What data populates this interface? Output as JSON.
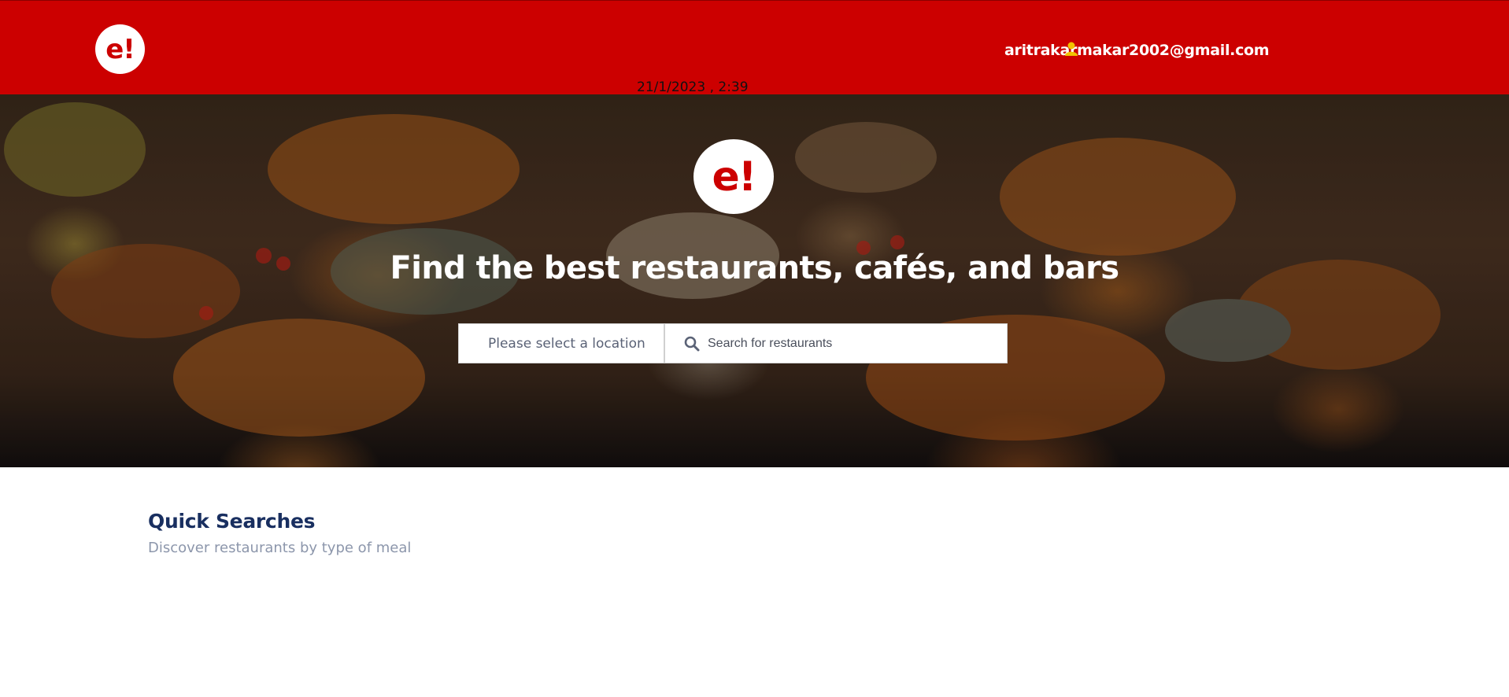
{
  "header": {
    "logo_text": "e!",
    "user_email": "aritrakarmakar2002@gmail.com",
    "datetime": "21/1/2023 , 2:39",
    "user_icon": "user-icon",
    "bg_color": "#cc0000"
  },
  "hero": {
    "logo_text": "e!",
    "title": "Find the best restaurants, cafés, and bars",
    "location_placeholder": "Please select a location",
    "search_placeholder": "Search for restaurants",
    "search_icon": "search-icon"
  },
  "quick_searches": {
    "title": "Quick Searches",
    "subtitle": "Discover restaurants by type of meal"
  },
  "colors": {
    "brand": "#cc0000",
    "heading": "#192f60",
    "muted": "#8c96ab"
  }
}
